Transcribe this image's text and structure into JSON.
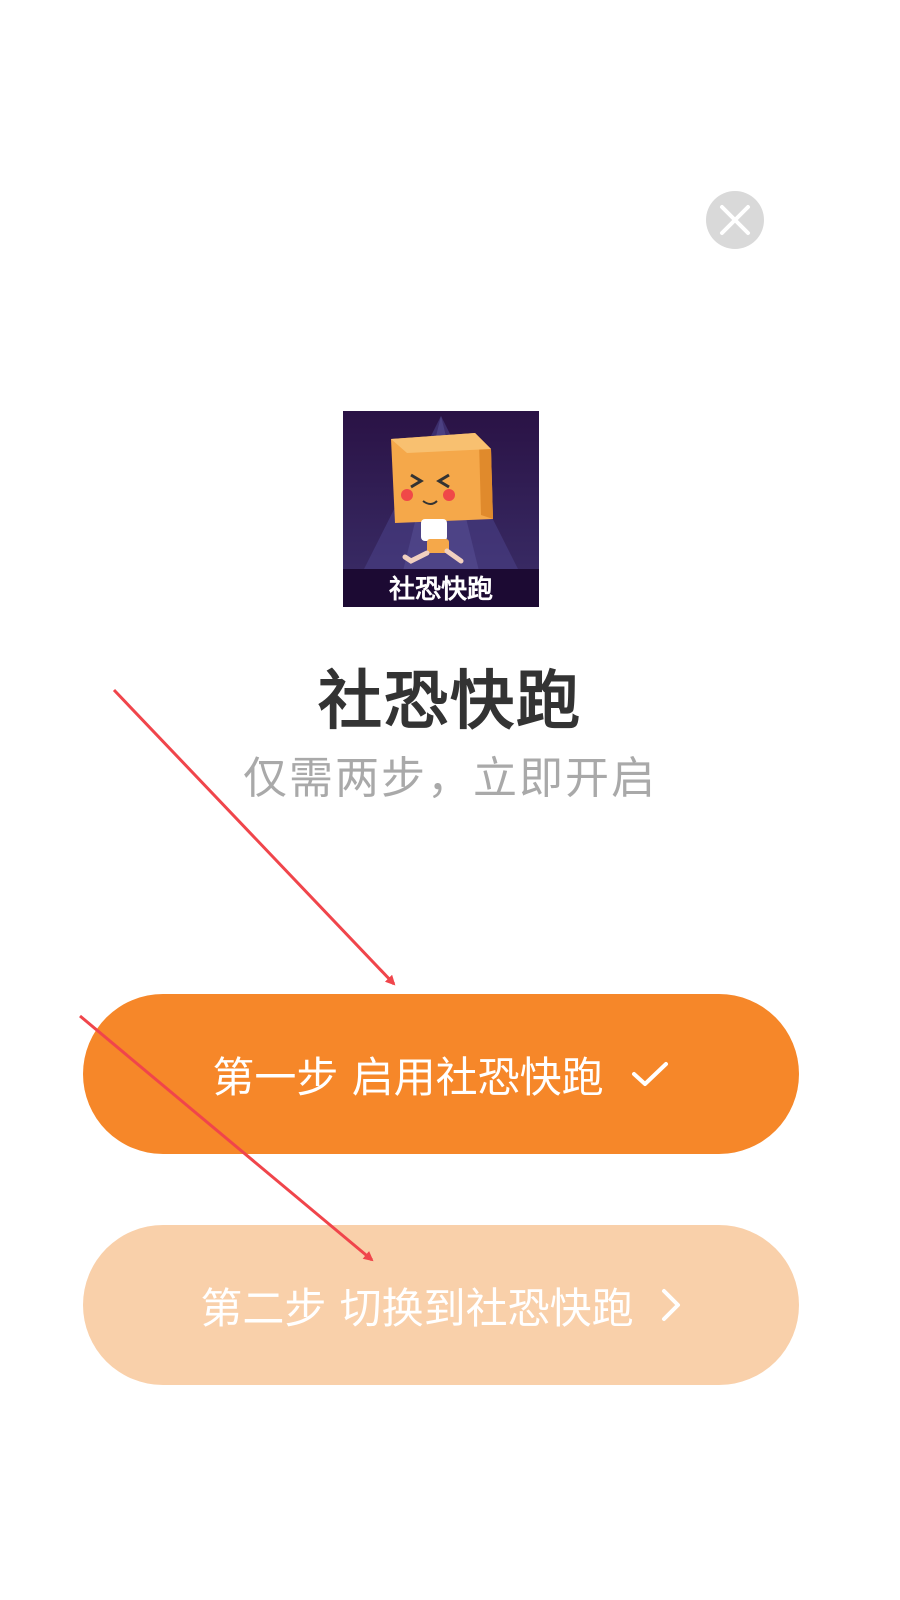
{
  "close_button": {
    "icon": "close-icon"
  },
  "app": {
    "icon_text": "社恐快跑",
    "title": "社恐快跑",
    "subtitle": "仅需两步，立即开启"
  },
  "steps": [
    {
      "label": "第一步 启用社恐快跑",
      "icon": "checkmark-icon",
      "state": "completed"
    },
    {
      "label": "第二步 切换到社恐快跑",
      "icon": "chevron-right-icon",
      "state": "pending"
    }
  ],
  "colors": {
    "accent": "#f68729",
    "accent_light": "#f9d0aa",
    "title": "#333333",
    "subtitle": "#a9a9a9",
    "close_bg": "#d9d9d9",
    "annotation_arrow": "#f0454b"
  }
}
